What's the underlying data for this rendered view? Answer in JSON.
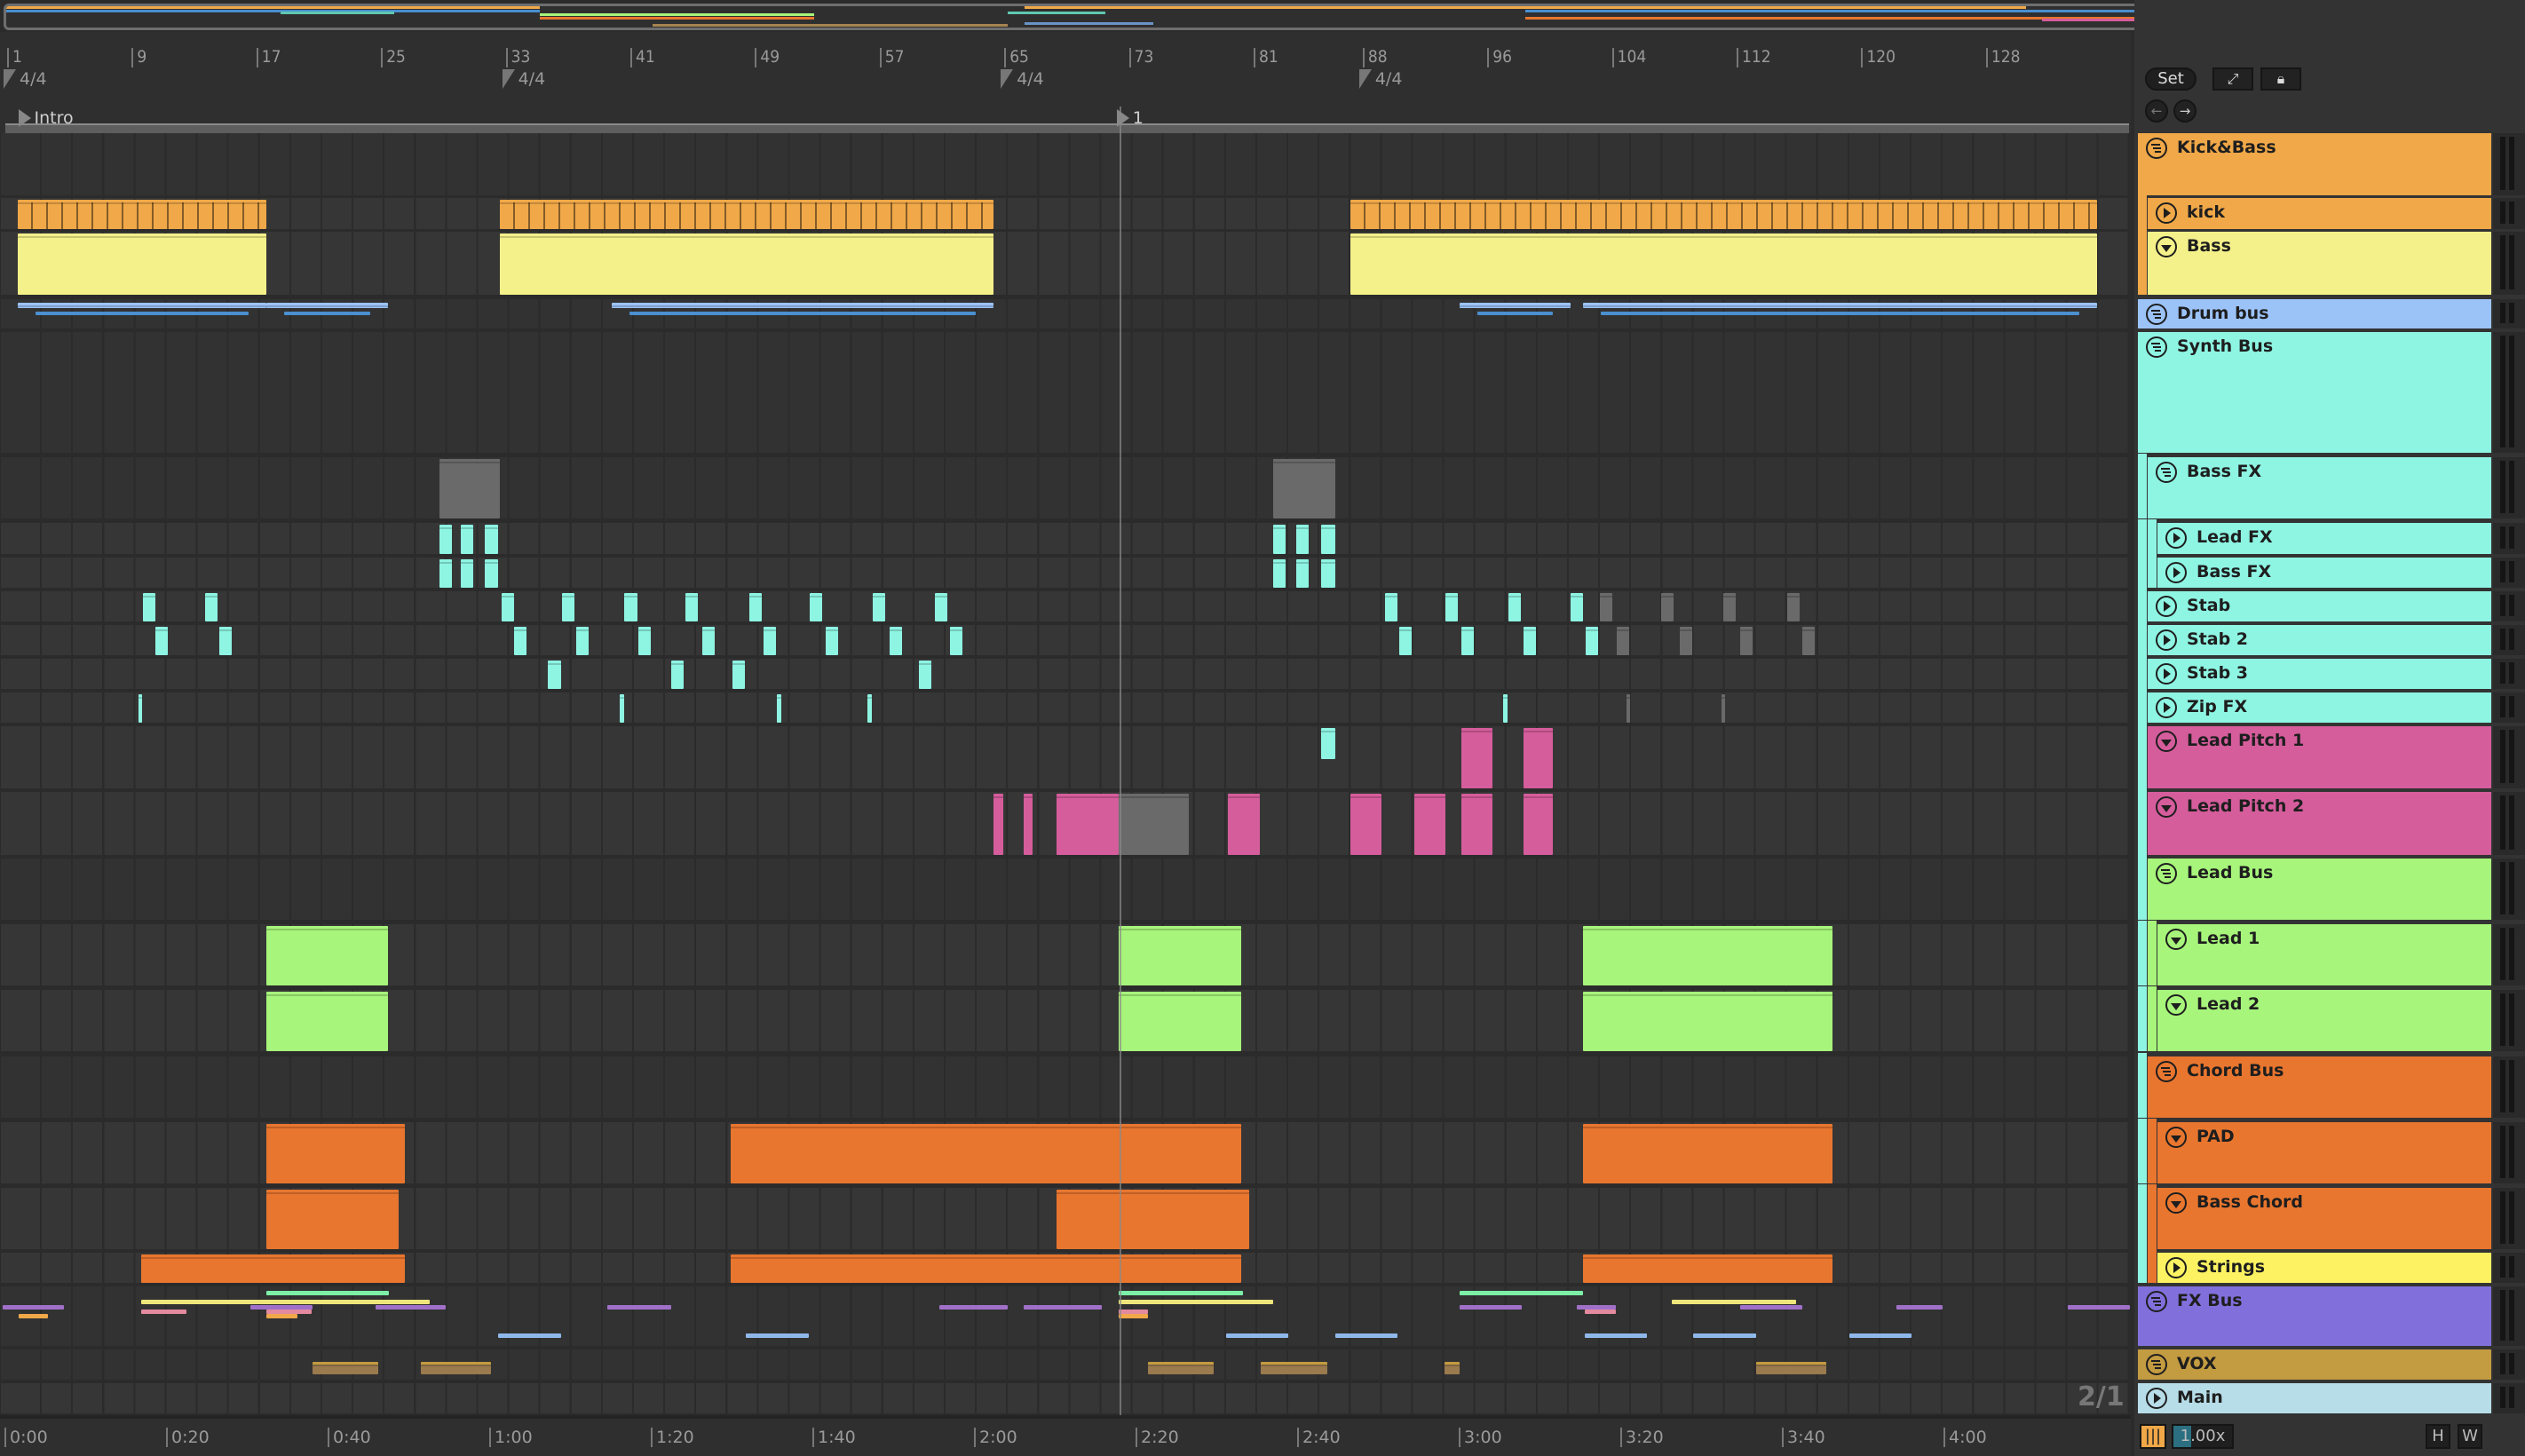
{
  "colors": {
    "orange": "#f0a848",
    "yellow": "#f5f18a",
    "blue": "#9cc3f8",
    "cyan": "#8ef5e3",
    "pink": "#d55d9c",
    "green": "#a7f57b",
    "dkorange": "#e8762f",
    "strings": "#fdf362",
    "purple": "#8170dc",
    "vox": "#c39b41",
    "main": "#b7dde8",
    "gray": "#6a6a6a"
  },
  "ruler": {
    "bars": [
      1,
      9,
      17,
      25,
      33,
      41,
      49,
      57,
      65,
      73,
      81,
      88,
      96,
      104,
      112,
      120,
      128
    ],
    "time_signatures": [
      {
        "bar": 1,
        "label": "4/4"
      },
      {
        "bar": 33,
        "label": "4/4"
      },
      {
        "bar": 65,
        "label": "4/4"
      },
      {
        "bar": 88,
        "label": "4/4"
      }
    ],
    "locators": [
      {
        "bar": 1.6,
        "label": "Intro"
      },
      {
        "bar": 72.1,
        "label": "1"
      }
    ],
    "times": [
      "0:00",
      "0:20",
      "0:40",
      "1:00",
      "1:20",
      "1:40",
      "2:00",
      "2:20",
      "2:40",
      "3:00",
      "3:20",
      "3:40",
      "4:00"
    ]
  },
  "controls": {
    "set": "Set",
    "zoom": "1.00x",
    "h": "H",
    "w": "W",
    "grid": "2/1"
  },
  "tracks": [
    {
      "name": "Kick&Bass",
      "color": "orange",
      "icon": "group",
      "depth": 0,
      "clips": []
    },
    {
      "name": "kick",
      "color": "orange",
      "icon": "play",
      "depth": 1,
      "tick": true,
      "clips": [
        [
          1.45,
          17.4
        ],
        [
          32.4,
          64.1
        ],
        [
          87,
          134.9
        ]
      ]
    },
    {
      "name": "Bass",
      "color": "yellow",
      "icon": "fold",
      "depth": 1,
      "clips": [
        [
          1.45,
          17.4
        ],
        [
          32.4,
          64.1
        ],
        [
          87,
          134.9
        ]
      ]
    },
    {
      "name": "Drum bus",
      "color": "blue",
      "icon": "group",
      "depth": 0,
      "thin": true,
      "clips": [
        [
          1.45,
          17.4
        ],
        [
          17.4,
          25.2
        ],
        [
          39.6,
          64.1
        ],
        [
          94,
          101.1
        ],
        [
          101.9,
          134.9
        ]
      ]
    },
    {
      "name": "Synth Bus",
      "color": "cyan",
      "icon": "group",
      "depth": 0,
      "clips": []
    },
    {
      "name": "Bass FX",
      "color": "cyan",
      "icon": "group",
      "depth": 1,
      "clips": [
        [
          28.5,
          32.4,
          "gray"
        ],
        [
          82,
          86,
          "gray"
        ]
      ]
    },
    {
      "name": "Lead FX",
      "color": "cyan",
      "icon": "play",
      "depth": 2,
      "clips": [
        [
          28.5,
          29.3
        ],
        [
          29.9,
          30.7
        ],
        [
          31.4,
          32.3
        ],
        [
          82,
          82.8
        ],
        [
          83.5,
          84.3
        ],
        [
          85.1,
          86
        ]
      ]
    },
    {
      "name": "Bass FX",
      "color": "cyan",
      "icon": "play",
      "depth": 2,
      "clips": [
        [
          28.5,
          29.3
        ],
        [
          29.9,
          30.7
        ],
        [
          31.4,
          32.3
        ],
        [
          82,
          82.8
        ],
        [
          83.5,
          84.3
        ],
        [
          85.1,
          86
        ]
      ]
    },
    {
      "name": "Stab",
      "color": "cyan",
      "icon": "play",
      "depth": 1,
      "clips": [
        [
          9.5,
          10.3
        ],
        [
          13.5,
          14.3
        ],
        [
          32.5,
          33.3
        ],
        [
          36.4,
          37.2
        ],
        [
          40.4,
          41.2
        ],
        [
          44.3,
          45.1
        ],
        [
          48.4,
          49.2
        ],
        [
          52.3,
          53.1
        ],
        [
          56.3,
          57.1
        ],
        [
          60.3,
          61.1
        ],
        [
          89.2,
          90
        ],
        [
          93.1,
          93.9
        ],
        [
          97.1,
          97.9
        ],
        [
          101.1,
          101.9
        ],
        [
          103,
          103.8,
          "gray"
        ],
        [
          106.9,
          107.7,
          "gray"
        ],
        [
          110.9,
          111.7,
          "gray"
        ],
        [
          115,
          115.8,
          "gray"
        ]
      ]
    },
    {
      "name": "Stab 2",
      "color": "cyan",
      "icon": "play",
      "depth": 1,
      "clips": [
        [
          10.3,
          11.1
        ],
        [
          14.4,
          15.2
        ],
        [
          33.3,
          34.1
        ],
        [
          37.3,
          38.1
        ],
        [
          41.3,
          42.1
        ],
        [
          45.4,
          46.2
        ],
        [
          49.3,
          50.1
        ],
        [
          53.3,
          54.1
        ],
        [
          57.4,
          58.2
        ],
        [
          61.3,
          62.1
        ],
        [
          90.1,
          90.9
        ],
        [
          94.1,
          94.9
        ],
        [
          98.1,
          98.9
        ],
        [
          102.1,
          102.9
        ],
        [
          104.1,
          104.9,
          "gray"
        ],
        [
          108.1,
          108.9,
          "gray"
        ],
        [
          112,
          112.8,
          "gray"
        ],
        [
          116,
          116.8,
          "gray"
        ]
      ]
    },
    {
      "name": "Stab 3",
      "color": "cyan",
      "icon": "play",
      "depth": 1,
      "clips": [
        [
          35.5,
          36.3
        ],
        [
          43.4,
          44.2
        ],
        [
          47.3,
          48.1
        ],
        [
          59.3,
          60.1
        ]
      ]
    },
    {
      "name": "Zip FX",
      "color": "cyan",
      "icon": "play",
      "depth": 1,
      "clips": [
        [
          9.2,
          9.45
        ],
        [
          40.1,
          40.35
        ],
        [
          50.2,
          50.45
        ],
        [
          56,
          56.25
        ],
        [
          96.8,
          97.05
        ],
        [
          104.7,
          104.95,
          "gray"
        ],
        [
          110.8,
          111.05,
          "gray"
        ]
      ]
    },
    {
      "name": "Lead Pitch 1",
      "color": "pink",
      "icon": "fold",
      "depth": 1,
      "clips": [
        [
          85.1,
          86,
          "cyan"
        ],
        [
          94.1,
          96.1
        ],
        [
          98.1,
          100
        ]
      ]
    },
    {
      "name": "Lead Pitch 2",
      "color": "pink",
      "icon": "fold",
      "depth": 1,
      "clips": [
        [
          64.1,
          64.7
        ],
        [
          66,
          66.6
        ],
        [
          68.1,
          72.1
        ],
        [
          72.1,
          76.6,
          "gray"
        ],
        [
          79.1,
          81.2
        ],
        [
          87,
          89
        ],
        [
          91.1,
          93.1
        ],
        [
          94.1,
          96.1
        ],
        [
          98.1,
          100
        ]
      ]
    },
    {
      "name": "Lead Bus",
      "color": "green",
      "icon": "group",
      "depth": 1,
      "clips": []
    },
    {
      "name": "Lead 1",
      "color": "green",
      "icon": "fold",
      "depth": 2,
      "clips": [
        [
          17.4,
          25.2
        ],
        [
          72.1,
          80
        ],
        [
          101.9,
          117.9
        ]
      ]
    },
    {
      "name": "Lead 2",
      "color": "green",
      "icon": "fold",
      "depth": 2,
      "clips": [
        [
          17.4,
          25.2
        ],
        [
          72.1,
          80
        ],
        [
          101.9,
          117.9
        ]
      ]
    },
    {
      "name": "Chord Bus",
      "color": "dkorange",
      "icon": "group",
      "depth": 1,
      "clips": []
    },
    {
      "name": "PAD",
      "color": "dkorange",
      "icon": "fold",
      "depth": 2,
      "clips": [
        [
          17.4,
          26.3
        ],
        [
          47.2,
          80
        ],
        [
          101.9,
          117.9
        ]
      ]
    },
    {
      "name": "Bass Chord",
      "color": "dkorange",
      "icon": "fold",
      "depth": 2,
      "clips": [
        [
          17.4,
          25.9
        ],
        [
          68.1,
          80.5
        ]
      ]
    },
    {
      "name": "Strings",
      "color": "strings",
      "icon": "play",
      "depth": 2,
      "clips": [
        [
          9.4,
          26.3,
          "dkorange"
        ],
        [
          47.2,
          80,
          "dkorange"
        ],
        [
          101.9,
          117.9,
          "dkorange"
        ]
      ]
    },
    {
      "name": "FX Bus",
      "color": "purple",
      "icon": "group",
      "depth": 0,
      "lines": [
        [
          17.4,
          25.3,
          0,
          "#7df0a8"
        ],
        [
          72.1,
          80.1,
          0,
          "#7df0a8"
        ],
        [
          94,
          101.9,
          0,
          "#7df0a8"
        ],
        [
          9.4,
          27.9,
          1,
          "#eee67a"
        ],
        [
          72.1,
          82,
          1,
          "#eee67a"
        ],
        [
          107.6,
          115.6,
          1,
          "#eee67a"
        ],
        [
          0.5,
          4.4,
          2,
          "#a070c8"
        ],
        [
          16.4,
          20.4,
          2,
          "#a070c8"
        ],
        [
          24.4,
          28.9,
          2,
          "#a070c8"
        ],
        [
          39.3,
          43.4,
          2,
          "#a070c8"
        ],
        [
          60.6,
          65,
          2,
          "#a070c8"
        ],
        [
          66,
          71,
          2,
          "#a070c8"
        ],
        [
          94,
          98,
          2,
          "#a070c8"
        ],
        [
          101.5,
          104,
          2,
          "#a070c8"
        ],
        [
          112,
          116,
          2,
          "#a070c8"
        ],
        [
          122,
          125,
          2,
          "#a070c8"
        ],
        [
          133,
          137,
          2,
          "#a070c8"
        ],
        [
          9.4,
          12.3,
          3,
          "#e38aa0"
        ],
        [
          17.4,
          20.3,
          3,
          "#e38aa0"
        ],
        [
          72.1,
          74,
          3,
          "#e38aa0"
        ],
        [
          102,
          104,
          3,
          "#e38aa0"
        ],
        [
          1.5,
          3.4,
          4,
          "#f0a848"
        ],
        [
          17.4,
          19.4,
          4,
          "#f0a848"
        ],
        [
          72.1,
          74,
          4,
          "#f0a848"
        ],
        [
          32.3,
          36.3,
          5,
          "#8fb8ea"
        ],
        [
          48.2,
          52.2,
          5,
          "#8fb8ea"
        ],
        [
          79,
          83,
          5,
          "#8fb8ea"
        ],
        [
          86,
          90,
          5,
          "#8fb8ea"
        ],
        [
          102,
          106,
          5,
          "#8fb8ea"
        ],
        [
          109,
          113,
          5,
          "#8fb8ea"
        ],
        [
          119,
          123,
          5,
          "#8fb8ea"
        ]
      ],
      "clips": []
    },
    {
      "name": "VOX",
      "color": "vox",
      "icon": "group",
      "depth": 0,
      "vox": true,
      "clips": [
        [
          20.4,
          24.6
        ],
        [
          27.3,
          31.8
        ],
        [
          74,
          78.2
        ],
        [
          81.2,
          85.5
        ],
        [
          93,
          94
        ],
        [
          113,
          117.5
        ]
      ]
    },
    {
      "name": "Main",
      "color": "main",
      "icon": "play",
      "depth": 0,
      "clips": []
    }
  ]
}
